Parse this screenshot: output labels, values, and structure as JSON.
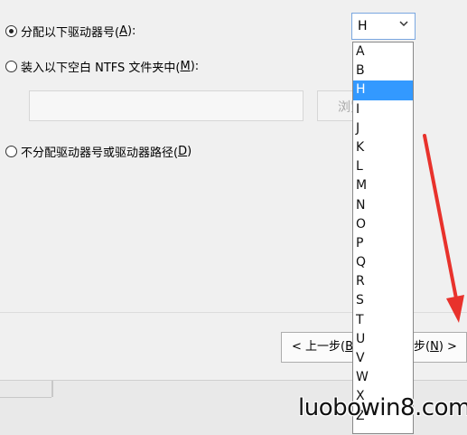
{
  "options": {
    "assign_letter": {
      "label": "分配以下驱动器号(",
      "key": "A",
      "suffix": "):",
      "checked": true
    },
    "mount_folder": {
      "label": "装入以下空白 NTFS 文件夹中(",
      "key": "M",
      "suffix": "):",
      "checked": false
    },
    "no_letter": {
      "label": "不分配驱动器号或驱动器路径(",
      "key": "D",
      "suffix": ")",
      "checked": false
    }
  },
  "path_input": {
    "value": ""
  },
  "browse_button": {
    "label": "浏览"
  },
  "drive_select": {
    "value": "H",
    "chevron_icon": "chevron-down-icon",
    "items": [
      "A",
      "B",
      "H",
      "I",
      "J",
      "K",
      "L",
      "M",
      "N",
      "O",
      "P",
      "Q",
      "R",
      "S",
      "T",
      "U",
      "V",
      "W",
      "X",
      "Z"
    ],
    "selected_index": 2
  },
  "navigation": {
    "back_label": "< 上一步(",
    "back_key": "B",
    "back_suffix": ")",
    "next_label": "步(",
    "next_key": "N",
    "next_suffix": ") >"
  },
  "annotation": {
    "arrow_color": "#e8322c"
  },
  "watermark": {
    "text": "luobowin8.com"
  }
}
